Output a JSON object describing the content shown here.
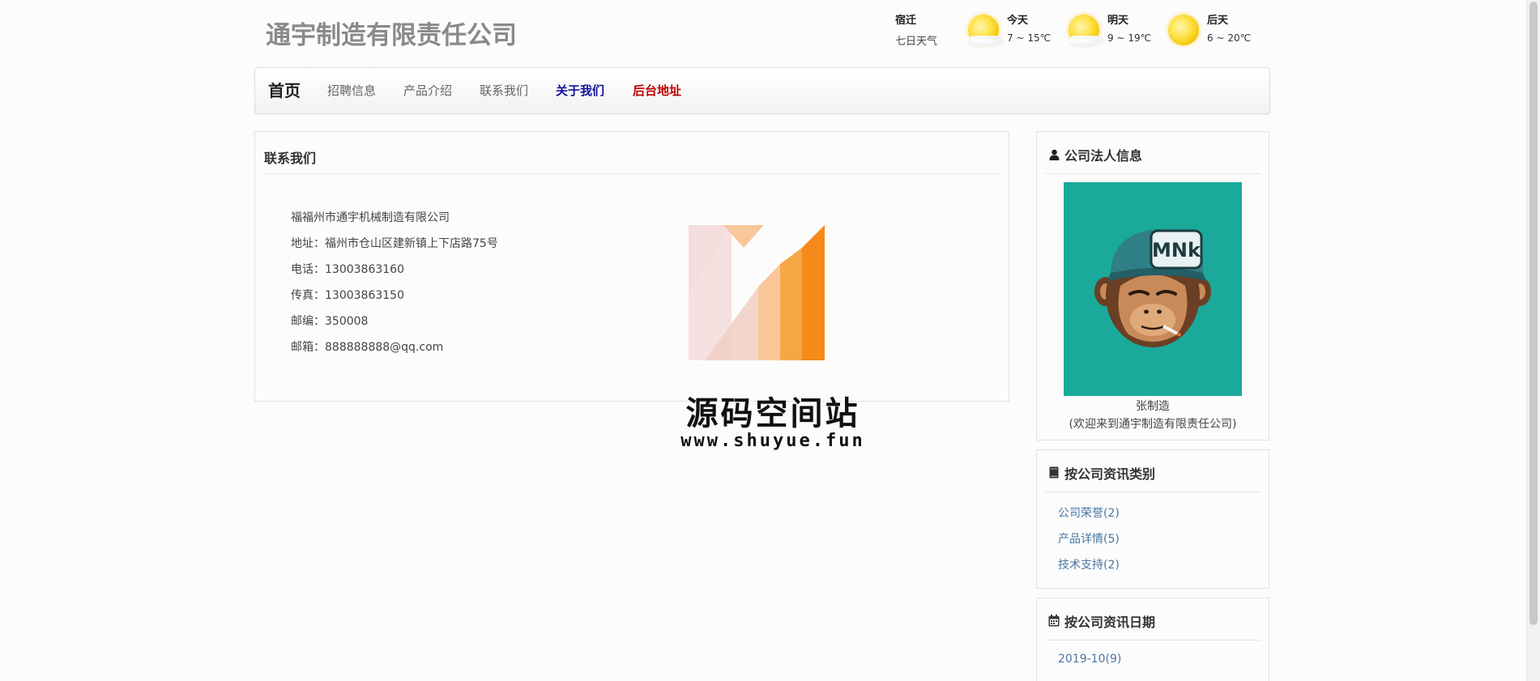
{
  "header": {
    "site_title": "通宇制造有限责任公司",
    "weather": {
      "city": "宿迁",
      "subtitle": "七日天气",
      "days": [
        {
          "label": "今天",
          "temp": "7 ~ 15℃",
          "icon": "sun-cloud-icon"
        },
        {
          "label": "明天",
          "temp": "9 ~ 19℃",
          "icon": "sun-cloud-icon"
        },
        {
          "label": "后天",
          "temp": "6 ~ 20℃",
          "icon": "sun-icon"
        }
      ]
    }
  },
  "nav": {
    "brand": "首页",
    "items": [
      "招聘信息",
      "产品介绍",
      "联系我们",
      "关于我们",
      "后台地址"
    ],
    "highlight_blue": "#10109a",
    "highlight_red": "#c00000"
  },
  "main": {
    "title": "联系我们",
    "lines": [
      "福福州市通宇机械制造有限公司",
      "地址：福州市仓山区建新镇上下店路75号",
      "电话：13003863160",
      "传真：13003863150",
      "邮编：350008",
      "邮箱：888888888@qq.com"
    ]
  },
  "watermark": {
    "text": "源码空间站",
    "url": "www.shuyue.fun",
    "logo_colors": [
      "#f4dedd",
      "#f9c79a",
      "#f7a646",
      "#f5891a"
    ]
  },
  "sidebar": {
    "legal": {
      "title": "公司法人信息",
      "icon": "user-icon",
      "avatar_bg": "#1aa99a",
      "name": "张制造",
      "desc": "(欢迎来到通宇制造有限责任公司)",
      "cap_text": "MNk"
    },
    "categories": {
      "title": "按公司资讯类别",
      "icon": "book-icon",
      "items": [
        "公司荣誉(2)",
        "产品详情(5)",
        "技术支持(2)"
      ]
    },
    "dates": {
      "title": "按公司资讯日期",
      "icon": "calendar-icon",
      "items": [
        "2019-10(9)"
      ]
    }
  },
  "colors": {
    "link": "#4a76a0",
    "title_gray": "#8a8a8a",
    "border": "#e2e2e2"
  }
}
